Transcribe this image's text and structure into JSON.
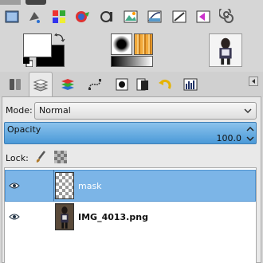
{
  "toolbox": {
    "row1": [
      "crop-tool",
      "select-tool"
    ],
    "row2": [
      {
        "name": "rectangle-select-icon"
      },
      {
        "name": "paint-bucket-icon"
      },
      {
        "name": "color-picker-grid-icon"
      },
      {
        "name": "color-circle-icon"
      },
      {
        "name": "levels-gear-icon"
      },
      {
        "name": "image-adjust-icon"
      },
      {
        "name": "curves-icon"
      },
      {
        "name": "measure-icon"
      },
      {
        "name": "paint-select-icon"
      },
      {
        "name": "swirl-icon"
      }
    ]
  },
  "colors": {
    "foreground": "#ffffff",
    "background": "#000000"
  },
  "mode": {
    "label": "Mode:",
    "value": "Normal"
  },
  "opacity": {
    "label": "Opacity",
    "value": "100.0",
    "percent": 100
  },
  "lock": {
    "label": "Lock:"
  },
  "layers": [
    {
      "name": "mask",
      "selected": true,
      "visible": true
    },
    {
      "name": "IMG_4013.png",
      "selected": false,
      "visible": true
    }
  ],
  "accent": "#4b9ad8"
}
